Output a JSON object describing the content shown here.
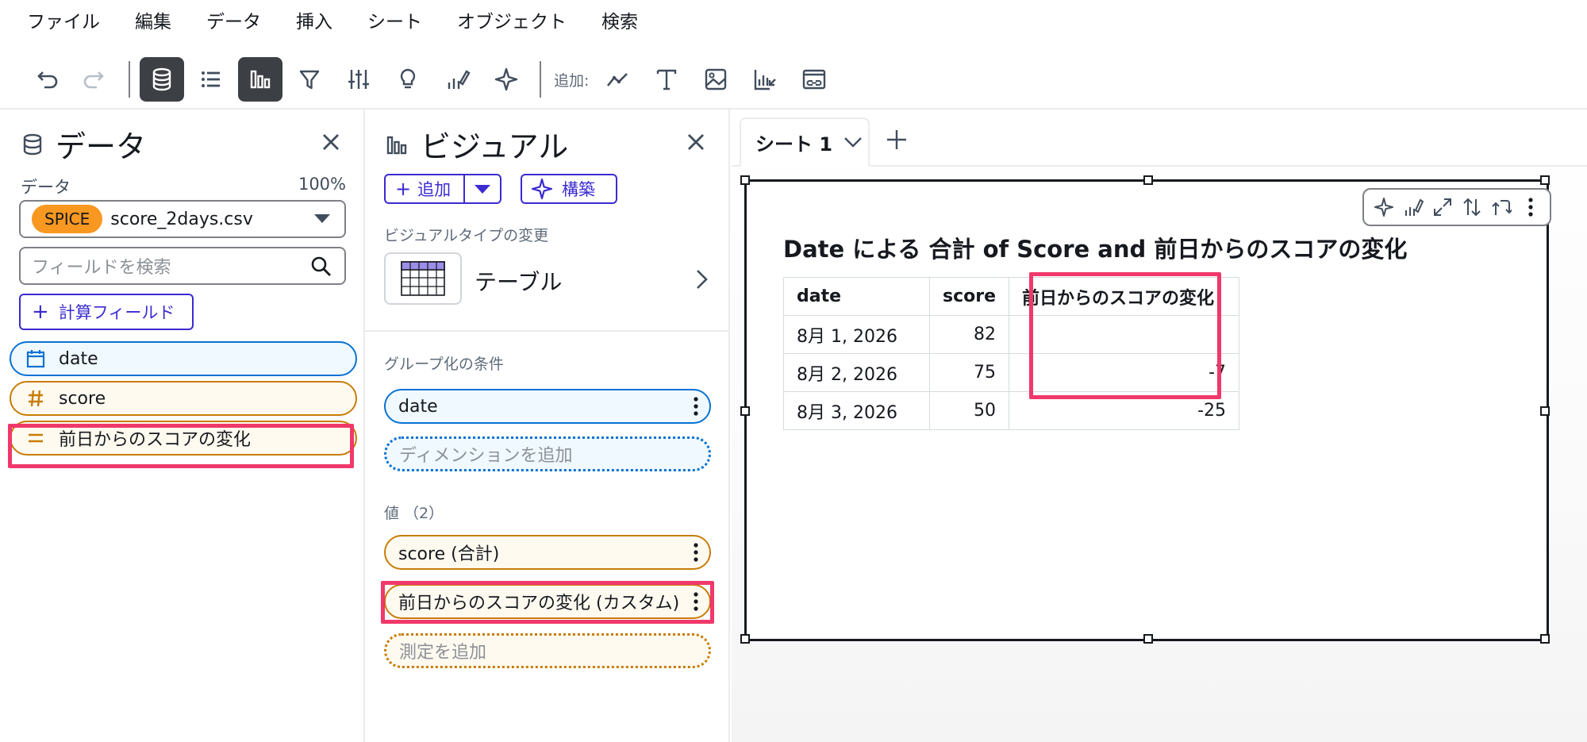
{
  "menu": [
    "ファイル",
    "編集",
    "データ",
    "挿入",
    "シート",
    "オブジェクト",
    "検索"
  ],
  "toolbar": {
    "add_label": "追加:"
  },
  "data_panel": {
    "title": "データ",
    "dataset_label": "データ",
    "dataset_percent": "100%",
    "spice_badge": "SPICE",
    "dataset_name": "score_2days.csv",
    "search_placeholder": "フィールドを検索",
    "calc_field_button": "計算フィールド",
    "fields": [
      {
        "name": "date",
        "type": "date"
      },
      {
        "name": "score",
        "type": "measure"
      },
      {
        "name": "前日からのスコアの変化",
        "type": "calculated"
      }
    ]
  },
  "visual_panel": {
    "title": "ビジュアル",
    "add_button": "追加",
    "build_button": "構築",
    "change_type_label": "ビジュアルタイプの変更",
    "visual_type": "テーブル",
    "group_by_label": "グループ化の条件",
    "group_by_field": "date",
    "add_dimension": "ディメンションを追加",
    "values_label": "値 （2）",
    "value_fields": [
      "score (合計)",
      "前日からのスコアの変化 (カスタム)"
    ],
    "add_measure": "測定を追加"
  },
  "canvas": {
    "sheet_tab": "シート 1",
    "visual_title": "Date による 合計 of Score and 前日からのスコアの変化",
    "table": {
      "headers": [
        "date",
        "score",
        "前日からのスコアの変化"
      ],
      "rows": [
        [
          "8月 1, 2026",
          "82",
          ""
        ],
        [
          "8月 2, 2026",
          "75",
          "-7"
        ],
        [
          "8月 3, 2026",
          "50",
          "-25"
        ]
      ]
    }
  },
  "colors": {
    "accent": "#3b2bd1",
    "highlight": "#f0386b",
    "spice": "#f89821",
    "dimension": "#0972d3",
    "measure": "#c77d07"
  }
}
